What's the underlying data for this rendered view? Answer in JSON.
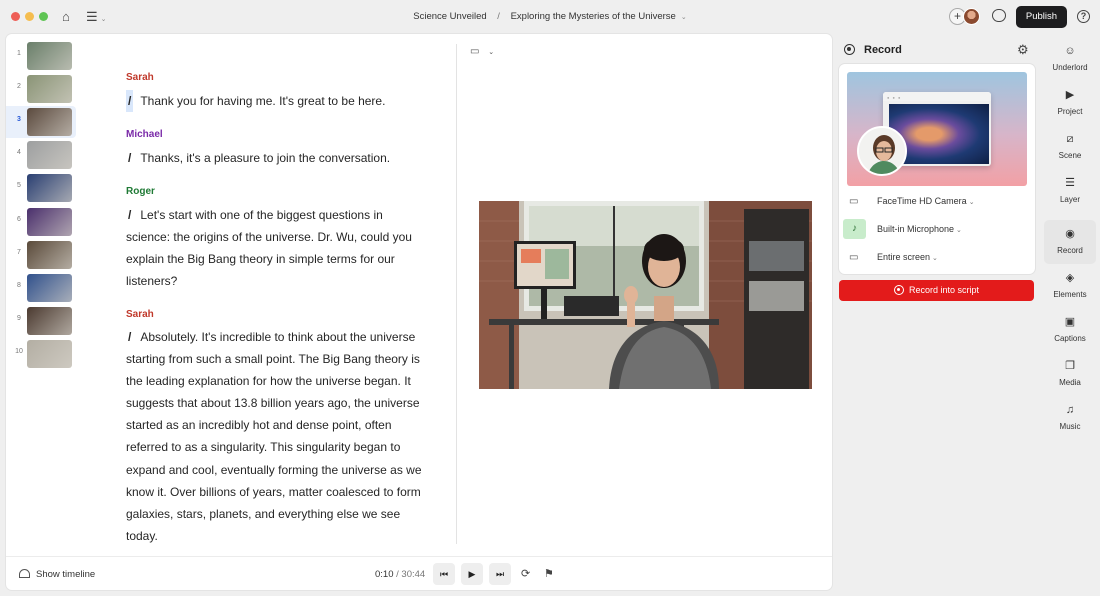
{
  "titlebar": {
    "project": "Science Unveiled",
    "separator": "/",
    "document": "Exploring the Mysteries of the Universe",
    "publish_label": "Publish",
    "icons": [
      "home-icon",
      "menu-icon",
      "add-collaborator-icon",
      "avatar",
      "comments-icon",
      "help-icon"
    ]
  },
  "scenes": [
    {
      "num": "1",
      "color": "#6a7f6a"
    },
    {
      "num": "2",
      "color": "#8a9476"
    },
    {
      "num": "3",
      "color": "#5b4a3e"
    },
    {
      "num": "4",
      "color": "#9d9fa0"
    },
    {
      "num": "5",
      "color": "#2a3f72"
    },
    {
      "num": "6",
      "color": "#4a2f6c"
    },
    {
      "num": "7",
      "color": "#5a4a3a"
    },
    {
      "num": "8",
      "color": "#31518c"
    },
    {
      "num": "9",
      "color": "#4b3a30"
    },
    {
      "num": "10",
      "color": "#b3aea3"
    }
  ],
  "active_scene": "3",
  "script": [
    {
      "speaker": "Sarah",
      "color": "#c0392b",
      "text": "Thank you for having me. It's great to be here.",
      "highlight": true
    },
    {
      "speaker": "Michael",
      "color": "#7a2aa8",
      "text": "Thanks, it's a pleasure to join the conversation.",
      "highlight": false
    },
    {
      "speaker": "Roger",
      "color": "#1f7a35",
      "text": "Let's start with one of the biggest questions in science: the origins of the universe. Dr. Wu, could you explain the Big Bang theory in simple terms for our listeners?",
      "highlight": false
    },
    {
      "speaker": "Sarah",
      "color": "#c0392b",
      "text": "Absolutely. It's incredible to think about the universe starting from such a small point. The Big Bang theory is the leading explanation for how the universe began. It suggests that about 13.8 billion years ago, the universe started as an incredibly hot and dense point, often referred to as a singularity. This singularity began to expand and cool, eventually forming the universe as we know it. Over billions of years, matter coalesced to form galaxies, stars, planets, and everything else we see today.",
      "highlight": false
    }
  ],
  "script_marker": "/",
  "playback": {
    "show_timeline_label": "Show timeline",
    "current_time": "0:10",
    "time_separator": "/",
    "total_time": "30:44"
  },
  "record_panel": {
    "title": "Record",
    "camera": "FaceTime HD Camera",
    "microphone": "Built-in Microphone",
    "screen": "Entire screen",
    "record_button": "Record into script"
  },
  "right_toolbar": [
    {
      "label": "Underlord",
      "icon": "underlord-icon",
      "glyph": "☺"
    },
    {
      "label": "Project",
      "icon": "project-icon",
      "glyph": "▶"
    },
    {
      "label": "Scene",
      "icon": "scene-icon",
      "glyph": "⧄"
    },
    {
      "label": "Layer",
      "icon": "layer-icon",
      "glyph": "☰"
    },
    {
      "label": "Record",
      "icon": "record-icon",
      "glyph": "◉"
    },
    {
      "label": "Elements",
      "icon": "elements-icon",
      "glyph": "◈"
    },
    {
      "label": "Captions",
      "icon": "captions-icon",
      "glyph": "▣"
    },
    {
      "label": "Media",
      "icon": "media-icon",
      "glyph": "❐"
    },
    {
      "label": "Music",
      "icon": "music-icon",
      "glyph": "♫"
    }
  ],
  "active_tool": "Record"
}
